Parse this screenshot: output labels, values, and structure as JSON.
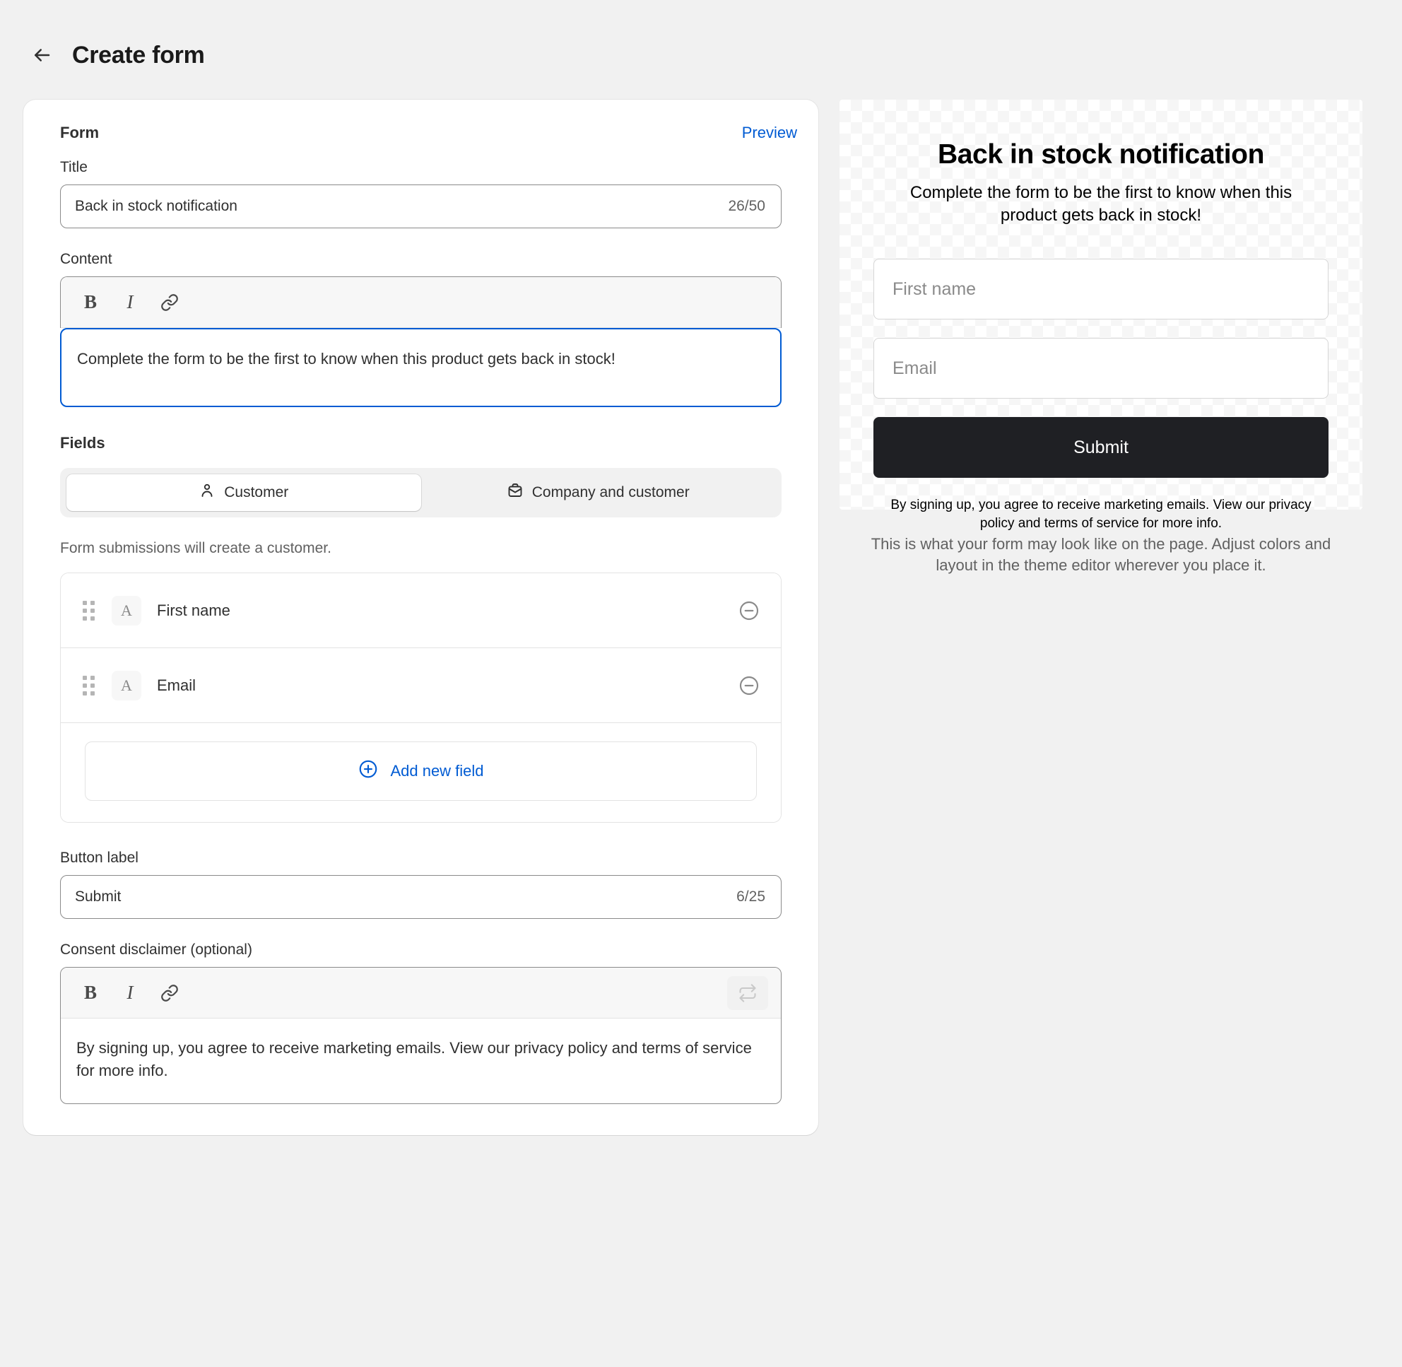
{
  "header": {
    "back_icon": "arrow-left-icon",
    "title": "Create form"
  },
  "form_card": {
    "section_label": "Form",
    "preview_link": "Preview",
    "title_field": {
      "label": "Title",
      "value": "Back in stock notification",
      "counter": "26/50"
    },
    "content_field": {
      "label": "Content",
      "toolbar": {
        "bold": "B",
        "italic": "I",
        "link": "link-icon"
      },
      "value": "Complete the form to be the first to know when this product gets back in stock!"
    },
    "fields_section": {
      "title": "Fields",
      "segmented_options": [
        {
          "label": "Customer",
          "icon": "person-icon",
          "active": true
        },
        {
          "label": "Company and customer",
          "icon": "briefcase-icon",
          "active": false
        }
      ],
      "helper_text": "Form submissions will create a customer.",
      "rows": [
        {
          "name": "First name",
          "type_icon": "text-type-icon",
          "type_glyph": "A"
        },
        {
          "name": "Email",
          "type_icon": "text-type-icon",
          "type_glyph": "A"
        }
      ],
      "add_field_label": "Add new field"
    },
    "button_label_field": {
      "label": "Button label",
      "value": "Submit",
      "counter": "6/25"
    },
    "consent_field": {
      "label": "Consent disclaimer (optional)",
      "toolbar": {
        "bold": "B",
        "italic": "I",
        "link": "link-icon",
        "reset": "reset-icon"
      },
      "value": "By signing up, you agree to receive marketing emails. View our privacy policy and terms of service for more info."
    }
  },
  "preview": {
    "title": "Back in stock notification",
    "subtitle": "Complete the form to be the first to know when this product gets back in stock!",
    "inputs": [
      {
        "placeholder": "First name"
      },
      {
        "placeholder": "Email"
      }
    ],
    "submit_label": "Submit",
    "disclaimer": "By signing up, you agree to receive marketing emails. View our privacy policy and terms of service for more info.",
    "caption": "This is what your form may look like on the page. Adjust colors and layout in the theme editor wherever you place it."
  },
  "colors": {
    "accent_link": "#005bd3",
    "page_bg": "#f1f1f1",
    "card_bg": "#ffffff",
    "submit_bg": "#1f2024",
    "focus_border": "#005bd3"
  }
}
